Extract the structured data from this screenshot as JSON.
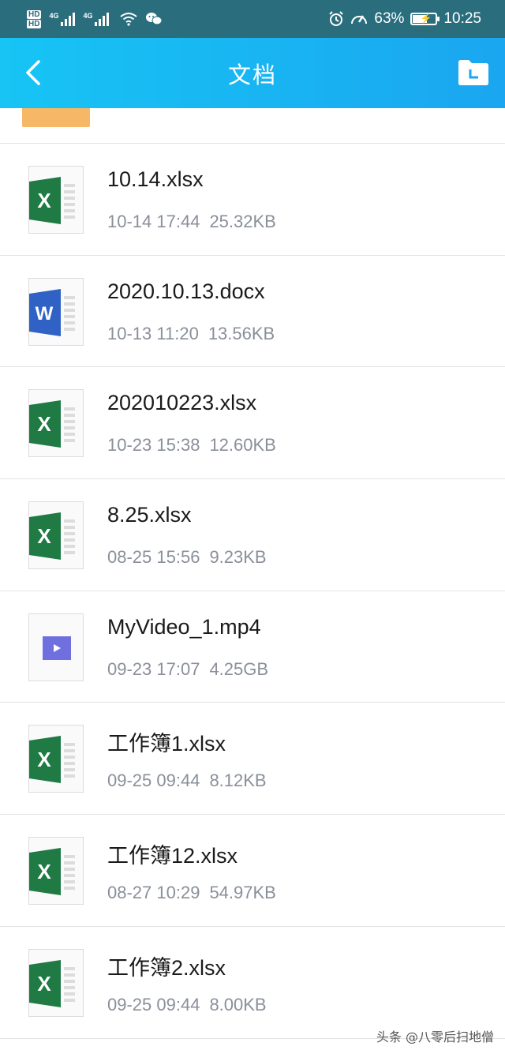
{
  "statusbar": {
    "hd1": "HD",
    "hd2": "HD",
    "sim1": "4G",
    "sim2": "4G",
    "battery_percent": "63%",
    "battery_level": 0.63,
    "time": "10:25",
    "icons": [
      "hd-icon",
      "signal-icon",
      "wifi-icon",
      "wechat-icon",
      "alarm-icon",
      "speed-icon",
      "battery-icon"
    ]
  },
  "header": {
    "title": "文档",
    "back_icon": "chevron-left-icon",
    "folder_icon": "folder-icon"
  },
  "files": [
    {
      "name": "10.14.xlsx",
      "date": "10-14 17:44",
      "size": "25.32KB",
      "type": "excel"
    },
    {
      "name": "2020.10.13.docx",
      "date": "10-13 11:20",
      "size": "13.56KB",
      "type": "word"
    },
    {
      "name": "202010223.xlsx",
      "date": "10-23 15:38",
      "size": "12.60KB",
      "type": "excel"
    },
    {
      "name": "8.25.xlsx",
      "date": "08-25 15:56",
      "size": "9.23KB",
      "type": "excel"
    },
    {
      "name": "MyVideo_1.mp4",
      "date": "09-23 17:07",
      "size": "4.25GB",
      "type": "video"
    },
    {
      "name": "工作簿1.xlsx",
      "date": "09-25 09:44",
      "size": "8.12KB",
      "type": "excel"
    },
    {
      "name": "工作簿12.xlsx",
      "date": "08-27 10:29",
      "size": "54.97KB",
      "type": "excel"
    },
    {
      "name": "工作簿2.xlsx",
      "date": "09-25 09:44",
      "size": "8.00KB",
      "type": "excel"
    }
  ],
  "colors": {
    "excel": "#1f7a44",
    "word": "#2f62c4",
    "video": "#6f6fe0",
    "header_start": "#17c4f4",
    "header_end": "#1aa6f0",
    "statusbar": "#2a6e7e"
  },
  "watermark": "头条 @八零后扫地僧"
}
